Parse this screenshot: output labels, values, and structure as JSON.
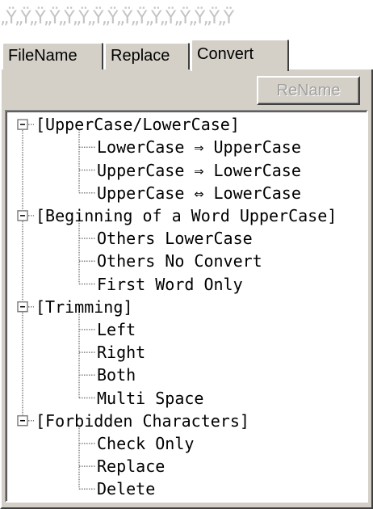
{
  "header": {
    "garbled_text": "„Ÿ„Ÿ„Ÿ„Ÿ„Ÿ„Ÿ„Ÿ„Ÿ„Ÿ„Ÿ„Ÿ„Ÿ„Ÿ„Ÿ„Ÿ„Ÿ"
  },
  "tabs": [
    {
      "label": "FileName"
    },
    {
      "label": "Replace"
    },
    {
      "label": "Convert"
    }
  ],
  "toolbar": {
    "rename_label": "ReName"
  },
  "tree": {
    "groups": [
      {
        "label": "[UpperCase/LowerCase]",
        "items": [
          "LowerCase ⇒ UpperCase",
          "UpperCase ⇒ LowerCase",
          "UpperCase ⇔ LowerCase"
        ]
      },
      {
        "label": "[Beginning of a Word UpperCase]",
        "items": [
          "Others LowerCase",
          "Others No Convert",
          "First Word Only"
        ]
      },
      {
        "label": "[Trimming]",
        "items": [
          "Left",
          "Right",
          "Both",
          "Multi Space"
        ]
      },
      {
        "label": "[Forbidden Characters]",
        "items": [
          "Check Only",
          "Replace",
          "Delete"
        ]
      }
    ]
  }
}
